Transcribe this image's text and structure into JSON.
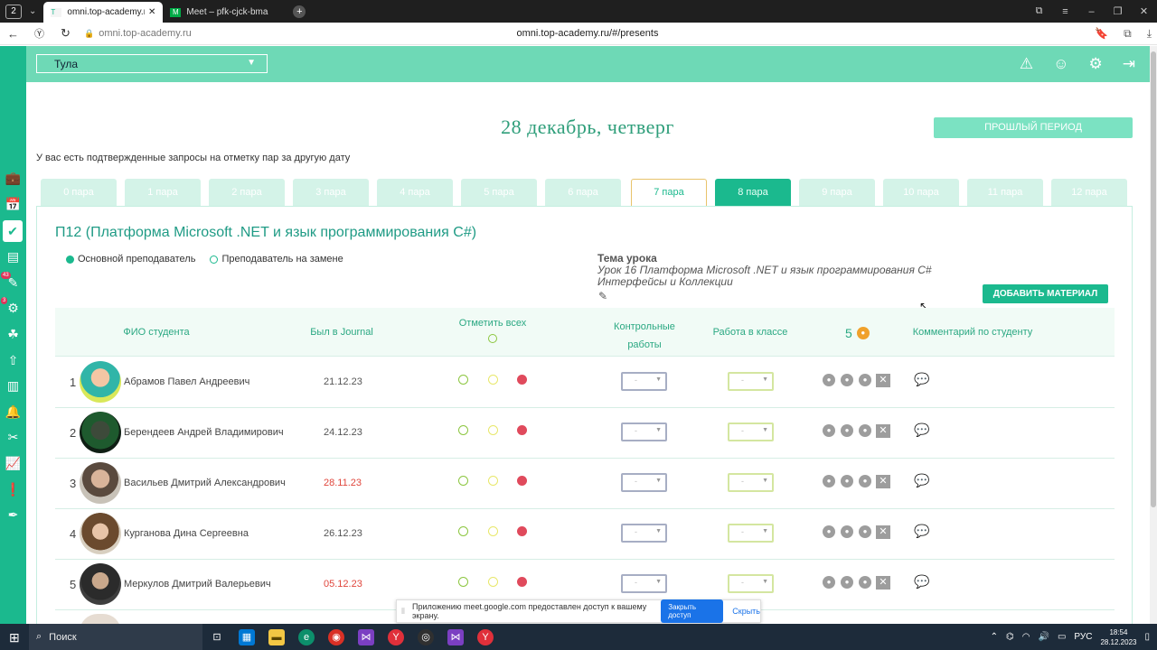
{
  "browser": {
    "tab_count": "2",
    "tabs": [
      {
        "title": "omni.top-academy.ru/#",
        "favicon": "T"
      },
      {
        "title": "Meet – pfk-cjck-bma",
        "favicon": "M"
      }
    ],
    "address_domain": "omni.top-academy.ru",
    "address_url": "omni.top-academy.ru/#/presents"
  },
  "sidebar": {
    "badges": [
      "43",
      "3"
    ]
  },
  "header": {
    "city": "Тула"
  },
  "page": {
    "date_title": "28 декабрь, четверг",
    "prev_period_label": "ПРОШЛЫЙ ПЕРИОД",
    "notice": "У вас есть подтвержденные запросы на отметку пар за другую дату",
    "periods": [
      "0 пара",
      "1 пара",
      "2 пара",
      "3 пара",
      "4 пара",
      "5 пара",
      "6 пара",
      "7 пара",
      "8 пара",
      "9 пара",
      "10 пара",
      "11 пара",
      "12 пара"
    ],
    "active_period": "7 пара",
    "filled_period": "8 пара"
  },
  "lesson": {
    "title": "П12    (Платформа Microsoft .NET и язык программирования C#)",
    "legend_main": "Основной преподаватель",
    "legend_sub": "Преподаватель на замене",
    "topic_heading": "Тема урока",
    "topic_text": "Урок 16 Платформа Microsoft .NET и язык программирования C# Интерфейсы и Коллекции",
    "add_material_label": "ДОБАВИТЬ МАТЕРИАЛ"
  },
  "table": {
    "col_name": "ФИО студента",
    "col_journal": "Был в Journal",
    "col_mark_all": "Отметить всех",
    "col_control_1": "Контрольные",
    "col_control_2": "работы",
    "col_classwork": "Работа в классе",
    "col_coins_value": "5",
    "col_comment": "Комментарий по студенту",
    "select_placeholder": "-",
    "rows": [
      {
        "num": "1",
        "name": "Абрамов Павел Андреевич",
        "journal": "21.12.23",
        "overdue": false
      },
      {
        "num": "2",
        "name": "Берендеев Андрей Владимирович",
        "journal": "24.12.23",
        "overdue": false
      },
      {
        "num": "3",
        "name": "Васильев Дмитрий Александрович",
        "journal": "28.11.23",
        "overdue": true
      },
      {
        "num": "4",
        "name": "Курганова Дина Сергеевна",
        "journal": "26.12.23",
        "overdue": false
      },
      {
        "num": "5",
        "name": "Меркулов Дмитрий Валерьевич",
        "journal": "05.12.23",
        "overdue": true
      }
    ]
  },
  "share_bar": {
    "message": "Приложению meet.google.com предоставлен доступ к вашему экрану.",
    "stop_label": "Закрыть доступ",
    "hide_label": "Скрыть"
  },
  "taskbar": {
    "search_label": "Поиск",
    "lang": "РУС",
    "time": "18:54",
    "date": "28.12.2023"
  },
  "colors": {
    "accent": "#1bb98e",
    "header": "#6ed9b6",
    "overdue": "#e0463c",
    "absent": "#e04a5c",
    "coin": "#f0a12b"
  }
}
